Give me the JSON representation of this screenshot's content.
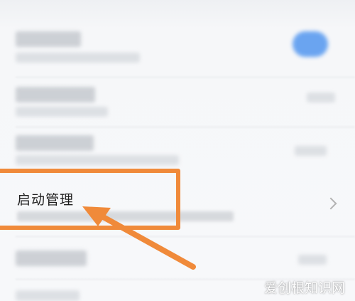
{
  "settings": {
    "startup_item": {
      "title": "启动管理"
    }
  },
  "annotation": {
    "highlight_color": "#f08a3a",
    "arrow_color": "#f08a3a"
  },
  "icons": {
    "chevron": "chevron-right-icon"
  },
  "watermark": {
    "text": "爱创根知识网"
  }
}
